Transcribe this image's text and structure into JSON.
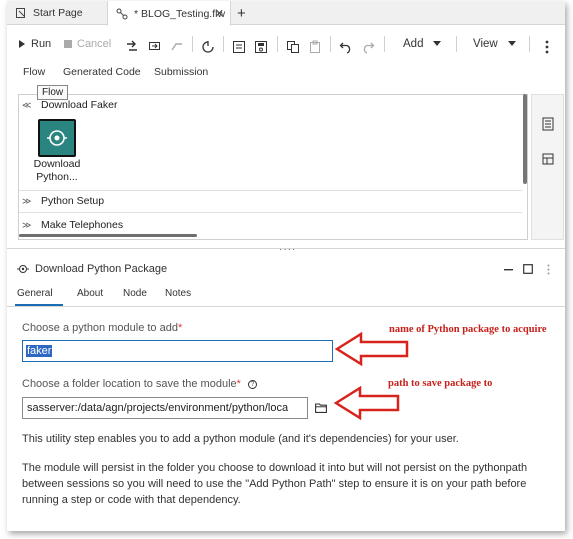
{
  "tabs": [
    {
      "label": "Start Page"
    },
    {
      "label": "* BLOG_Testing.flw"
    }
  ],
  "tab_close_glyph": "✕",
  "tab_add_glyph": "+",
  "toolbar": {
    "run_label": "Run",
    "cancel_label": "Cancel",
    "add_label": "Add",
    "view_label": "View"
  },
  "subnav": {
    "items": [
      "Flow",
      "Generated Code",
      "Submission"
    ],
    "tooltip": "Flow"
  },
  "flow": {
    "sections": [
      {
        "label": "Download Faker"
      },
      {
        "label": "Python Setup"
      },
      {
        "label": "Make Telephones"
      }
    ],
    "node": {
      "label_line1": "Download",
      "label_line2": "Python..."
    }
  },
  "properties": {
    "title": "Download Python Package",
    "tabs": [
      "General",
      "About",
      "Node",
      "Notes"
    ],
    "module_label": "Choose a python module to add",
    "module_value": "faker",
    "folder_label": "Choose a folder location to save the module",
    "folder_value": "sasserver:/data/agn/projects/environment/python/loca",
    "required_mark": "*",
    "desc1": "This utility step enables you to add a python module (and it's dependencies) for your user.",
    "desc2": "The module will persist in the folder you choose to download it into but will not persist on the pythonpath between sessions so you will need to use the \"Add Python Path\" step to ensure it is on your path before running a step or code with that dependency."
  },
  "annotations": {
    "package_note": "name of Python package to acquire",
    "path_note": "path to save package to"
  },
  "colors": {
    "accent": "#1b6eb6",
    "node_teal": "#2a8480",
    "annotation_red": "#c8201a"
  }
}
